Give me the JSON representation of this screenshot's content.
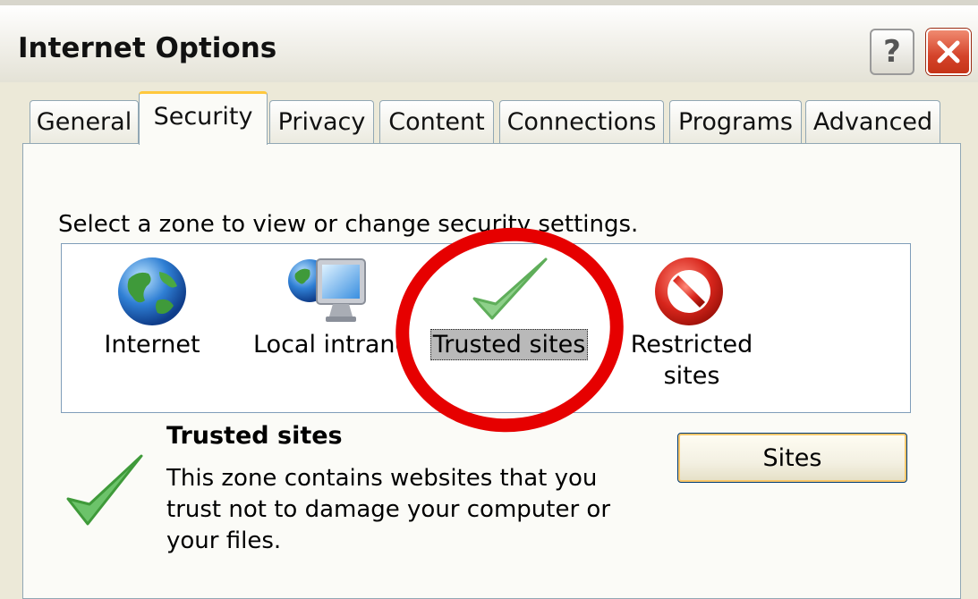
{
  "window": {
    "title": "Internet Options",
    "help_label": "?"
  },
  "tabs": [
    {
      "label": "General",
      "active": false
    },
    {
      "label": "Security",
      "active": true
    },
    {
      "label": "Privacy",
      "active": false
    },
    {
      "label": "Content",
      "active": false
    },
    {
      "label": "Connections",
      "active": false
    },
    {
      "label": "Programs",
      "active": false
    },
    {
      "label": "Advanced",
      "active": false
    }
  ],
  "security": {
    "instruction": "Select a zone to view or change security settings.",
    "zones": [
      {
        "label": "Internet",
        "icon": "globe-icon",
        "selected": false
      },
      {
        "label": "Local intranet",
        "icon": "intranet-monitor-icon",
        "selected": false
      },
      {
        "label": "Trusted sites",
        "icon": "green-checkmark-icon",
        "selected": true
      },
      {
        "label": "Restricted sites",
        "icon": "no-entry-icon",
        "selected": false
      }
    ],
    "selected_zone": {
      "title": "Trusted sites",
      "description": "This zone contains websites that you trust not to damage your computer or your files.",
      "icon": "green-checkmark-icon"
    },
    "sites_button_label": "Sites"
  },
  "colors": {
    "annotation_circle": "#e60000",
    "tab_highlight": "#ffc83c",
    "close_button": "#d4432a"
  }
}
